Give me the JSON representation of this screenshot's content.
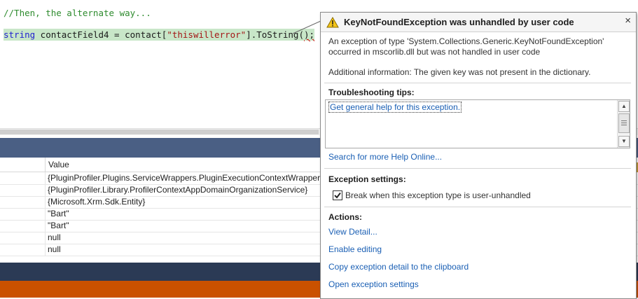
{
  "editor": {
    "comment": "//Then, the alternate way...",
    "stmt_type": "string",
    "stmt_pre": " contactField4 = contact[",
    "stmt_string": "\"thiswillerror\"",
    "stmt_post_a": "].ToString(",
    "stmt_post_b": ");"
  },
  "locals": {
    "value_header": "Value",
    "rows": [
      "{PluginProfiler.Plugins.ServiceWrappers.PluginExecutionContextWrapper}",
      "{PluginProfiler.Library.ProfilerContextAppDomainOrganizationService}",
      "{Microsoft.Xrm.Sdk.Entity}",
      "\"Bart\"",
      "\"Bart\"",
      "null",
      "null"
    ]
  },
  "popup": {
    "title": "KeyNotFoundException was unhandled by user code",
    "close_glyph": "×",
    "message_line1": "An exception of type 'System.Collections.Generic.KeyNotFoundException'",
    "message_line2": "occurred in mscorlib.dll but was not handled in user code",
    "additional_info": "Additional information: The given key was not present in the dictionary.",
    "tips_heading": "Troubleshooting tips:",
    "tip_link": "Get general help for this exception.",
    "search_link": "Search for more Help Online...",
    "settings_heading": "Exception settings:",
    "break_checkbox_label": "Break when this exception type is user-unhandled",
    "break_checked": true,
    "actions_heading": "Actions:",
    "actions": [
      "View Detail...",
      "Enable editing",
      "Copy exception detail to the clipboard",
      "Open exception settings"
    ]
  },
  "colors": {
    "pane_header": "#4a5f84",
    "status_dark": "#2b3a55",
    "status_orange": "#ca5100",
    "link": "#1a5fb4",
    "highlight": "#c8e6c8"
  }
}
